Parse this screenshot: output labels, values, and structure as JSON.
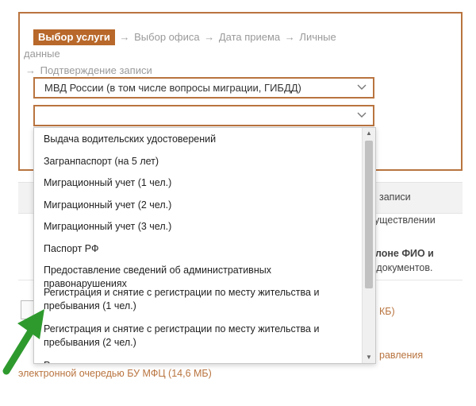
{
  "steps": {
    "active": "Выбор услуги",
    "items": [
      "Выбор офиса",
      "Дата приема",
      "Личные данные",
      "Подтверждение записи"
    ],
    "arrow": "→"
  },
  "agency_select": {
    "value": "МВД России (в том числе вопросы миграции, ГИБДД)"
  },
  "service_select": {
    "value": ""
  },
  "dropdown": {
    "options": [
      "Выдача водительских удостоверений",
      "Загранпаспорт (на 5 лет)",
      "Миграционный учет (1 чел.)",
      "Миграционный учет (2 чел.)",
      "Миграционный учет (3 чел.)",
      "Паспорт РФ",
      "Предоставление сведений об административных правонарушениях",
      "Регистрация и снятие с регистрации по месту жительства и пребывания (1 чел.)",
      "Регистрация и снятие с регистрации по месту жительства и пребывания (2 чел.)",
      "Регистрация и снятие с регистрации по месту жительства и"
    ]
  },
  "background": {
    "bar_text": "записи",
    "line1": "уществлении",
    "line2": "алоне ФИО и",
    "line3": "е документов.",
    "file_size": "КБ)",
    "link_tail": "равления",
    "link_bottom": "электронной очередью БУ МФЦ (14,6 МБ)"
  },
  "colors": {
    "accent": "#b8682a",
    "border": "#b9743f",
    "arrow_green": "#2e9a2e"
  }
}
